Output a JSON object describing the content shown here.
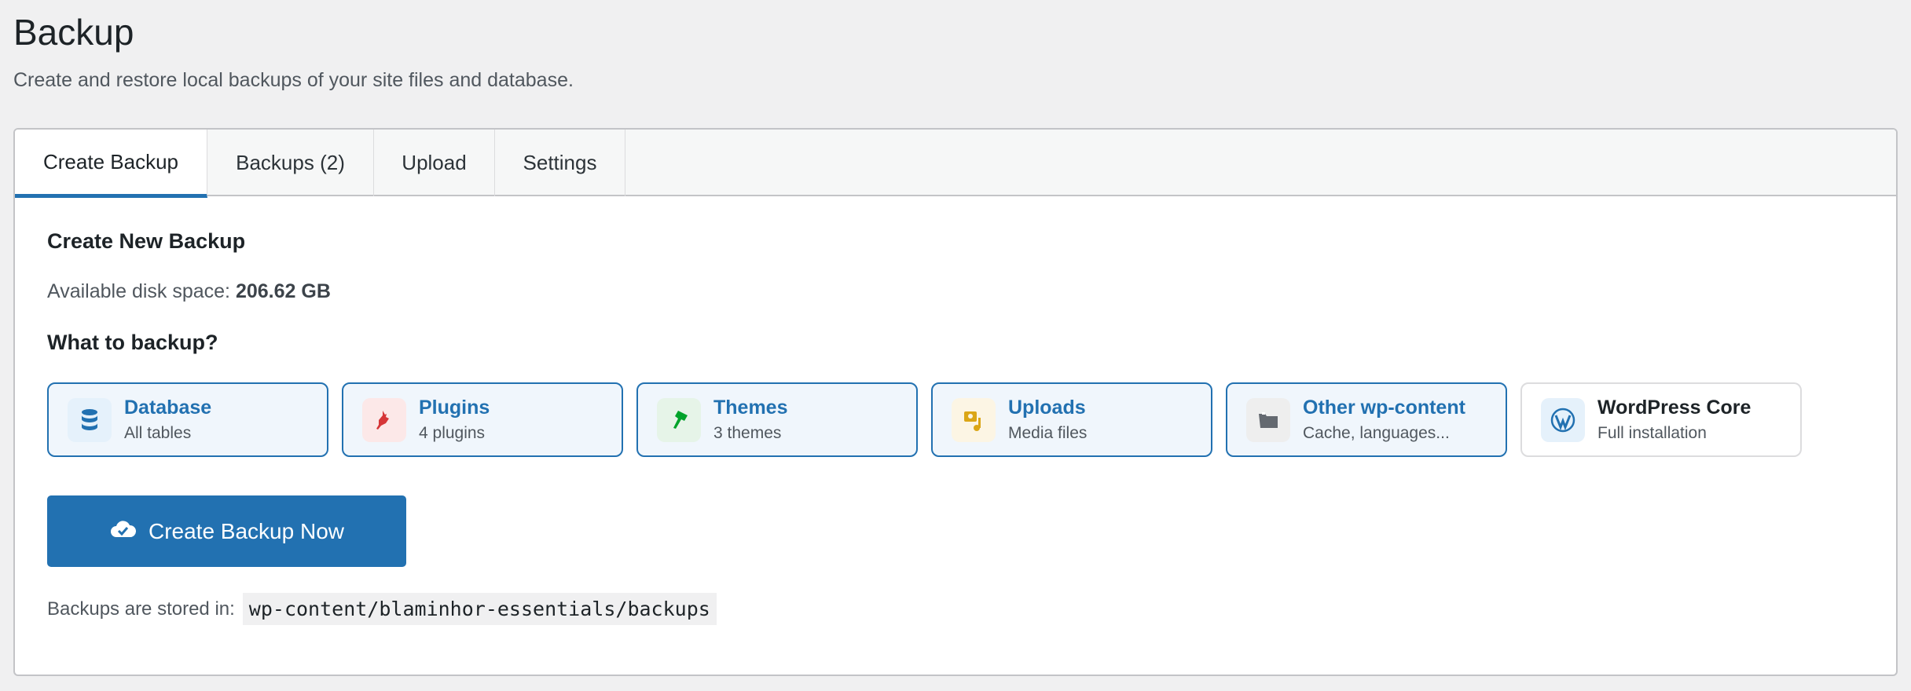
{
  "page": {
    "title": "Backup",
    "subtitle": "Create and restore local backups of your site files and database."
  },
  "tabs": [
    {
      "label": "Create Backup"
    },
    {
      "label": "Backups (2)"
    },
    {
      "label": "Upload"
    },
    {
      "label": "Settings"
    }
  ],
  "create": {
    "heading": "Create New Backup",
    "disk_label": "Available disk space:",
    "disk_value": "206.62 GB",
    "what_heading": "What to backup?",
    "options": [
      {
        "label": "Database",
        "sub": "All tables",
        "icon": "database-icon",
        "selected": true
      },
      {
        "label": "Plugins",
        "sub": "4 plugins",
        "icon": "plugin-icon",
        "selected": true
      },
      {
        "label": "Themes",
        "sub": "3 themes",
        "icon": "brush-icon",
        "selected": true
      },
      {
        "label": "Uploads",
        "sub": "Media files",
        "icon": "media-icon",
        "selected": true
      },
      {
        "label": "Other wp-content",
        "sub": "Cache, languages...",
        "icon": "folder-icon",
        "selected": true
      },
      {
        "label": "WordPress Core",
        "sub": "Full installation",
        "icon": "wordpress-icon",
        "selected": false
      }
    ],
    "button": "Create Backup Now",
    "stored_label": "Backups are stored in:",
    "stored_path": "wp-content/blaminhor-essentials/backups"
  },
  "colors": {
    "accent": "#2271b1"
  }
}
